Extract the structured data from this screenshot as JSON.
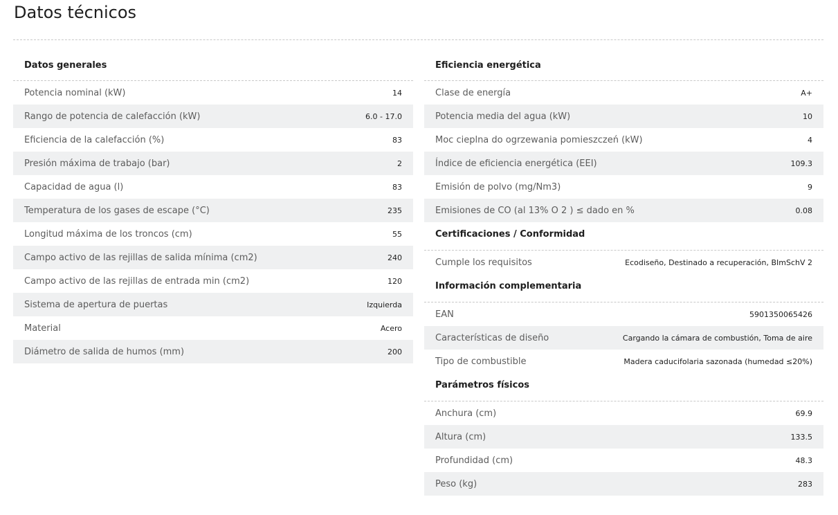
{
  "page": {
    "title": "Datos técnicos"
  },
  "left": {
    "sections": [
      {
        "heading": "Datos generales",
        "rows": [
          {
            "label": "Potencia nominal (kW)",
            "value": "14"
          },
          {
            "label": "Rango de potencia de calefacción (kW)",
            "value": "6.0 - 17.0"
          },
          {
            "label": "Eficiencia de la calefacción (%)",
            "value": "83"
          },
          {
            "label": "Presión máxima de trabajo (bar)",
            "value": "2"
          },
          {
            "label": "Capacidad de agua (l)",
            "value": "83"
          },
          {
            "label": "Temperatura de los gases de escape (°C)",
            "value": "235"
          },
          {
            "label": "Longitud máxima de los troncos (cm)",
            "value": "55"
          },
          {
            "label": "Campo activo de las rejillas de salida mínima (cm2)",
            "value": "240"
          },
          {
            "label": "Campo activo de las rejillas de entrada min (cm2)",
            "value": "120"
          },
          {
            "label": "Sistema de apertura de puertas",
            "value": "Izquierda"
          },
          {
            "label": "Material",
            "value": "Acero"
          },
          {
            "label": "Diámetro de salida de humos (mm)",
            "value": "200"
          }
        ]
      }
    ]
  },
  "right": {
    "sections": [
      {
        "heading": "Eficiencia energética",
        "rows": [
          {
            "label": "Clase de energía",
            "value": "A+"
          },
          {
            "label": "Potencia media del agua (kW)",
            "value": "10"
          },
          {
            "label": "Moc cieplna do ogrzewania pomieszczeń (kW)",
            "value": "4"
          },
          {
            "label": "Índice de eficiencia energética (EEI)",
            "value": "109.3"
          },
          {
            "label": "Emisión de polvo (mg/Nm3)",
            "value": "9"
          },
          {
            "label": "Emisiones de CO (al 13% O 2 ) ≤ dado en %",
            "value": "0.08"
          }
        ]
      },
      {
        "heading": "Certificaciones / Conformidad",
        "rows": [
          {
            "label": "Cumple los requisitos",
            "value": "Ecodiseño, Destinado a recuperación, BImSchV 2"
          }
        ]
      },
      {
        "heading": "Información complementaria",
        "rows": [
          {
            "label": "EAN",
            "value": "5901350065426"
          },
          {
            "label": "Características de diseño",
            "value": "Cargando la cámara de combustión, Toma de aire"
          },
          {
            "label": "Tipo de combustible",
            "value": "Madera caducifolaria sazonada (humedad ≤20%)"
          }
        ]
      },
      {
        "heading": "Parámetros físicos",
        "rows": [
          {
            "label": "Anchura (cm)",
            "value": "69.9"
          },
          {
            "label": "Altura (cm)",
            "value": "133.5"
          },
          {
            "label": "Profundidad (cm)",
            "value": "48.3"
          },
          {
            "label": "Peso (kg)",
            "value": "283"
          }
        ]
      }
    ]
  }
}
